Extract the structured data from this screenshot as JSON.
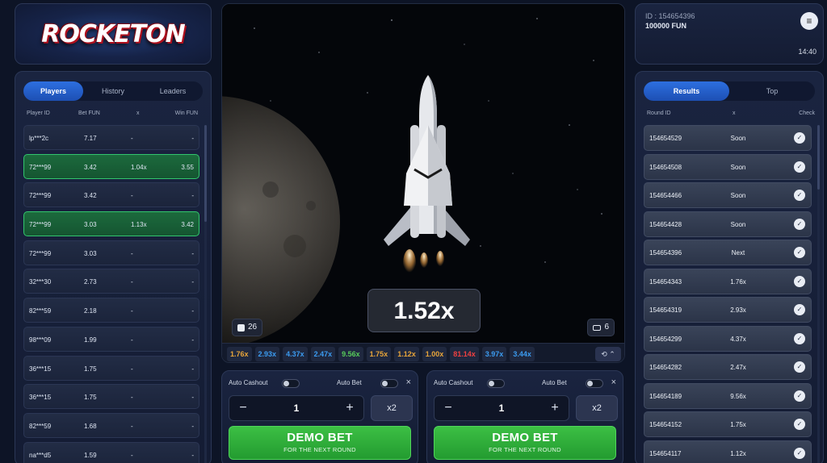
{
  "logo": {
    "text": "ROCKETON"
  },
  "players": {
    "tabs": [
      {
        "label": "Players",
        "active": true
      },
      {
        "label": "History",
        "active": false
      },
      {
        "label": "Leaders",
        "active": false
      }
    ],
    "columns": {
      "player_id": "Player ID",
      "bet": "Bet FUN",
      "x": "x",
      "win": "Win FUN"
    },
    "rows": [
      {
        "id": "lp***2c",
        "bet": "7.17",
        "x": "-",
        "win": "-",
        "won": false
      },
      {
        "id": "72***99",
        "bet": "3.42",
        "x": "1.04x",
        "win": "3.55",
        "won": true
      },
      {
        "id": "72***99",
        "bet": "3.42",
        "x": "-",
        "win": "-",
        "won": false
      },
      {
        "id": "72***99",
        "bet": "3.03",
        "x": "1.13x",
        "win": "3.42",
        "won": true
      },
      {
        "id": "72***99",
        "bet": "3.03",
        "x": "-",
        "win": "-",
        "won": false
      },
      {
        "id": "32***30",
        "bet": "2.73",
        "x": "-",
        "win": "-",
        "won": false
      },
      {
        "id": "82***59",
        "bet": "2.18",
        "x": "-",
        "win": "-",
        "won": false
      },
      {
        "id": "98***09",
        "bet": "1.99",
        "x": "-",
        "win": "-",
        "won": false
      },
      {
        "id": "36***15",
        "bet": "1.75",
        "x": "-",
        "win": "-",
        "won": false
      },
      {
        "id": "36***15",
        "bet": "1.75",
        "x": "-",
        "win": "-",
        "won": false
      },
      {
        "id": "82***59",
        "bet": "1.68",
        "x": "-",
        "win": "-",
        "won": false
      },
      {
        "id": "na***d5",
        "bet": "1.59",
        "x": "-",
        "win": "-",
        "won": false
      }
    ]
  },
  "game": {
    "multiplier": "1.52x",
    "players_count": "26",
    "bets_count": "6",
    "history": [
      {
        "value": "1.76x",
        "color": "#e8a53a"
      },
      {
        "value": "2.93x",
        "color": "#3b9bf0"
      },
      {
        "value": "4.37x",
        "color": "#3b9bf0"
      },
      {
        "value": "2.47x",
        "color": "#3b9bf0"
      },
      {
        "value": "9.56x",
        "color": "#57cc5a"
      },
      {
        "value": "1.75x",
        "color": "#e8a53a"
      },
      {
        "value": "1.12x",
        "color": "#e8a53a"
      },
      {
        "value": "1.00x",
        "color": "#e8a53a"
      },
      {
        "value": "81.14x",
        "color": "#f04040"
      },
      {
        "value": "3.97x",
        "color": "#3b9bf0"
      },
      {
        "value": "3.44x",
        "color": "#3b9bf0"
      }
    ]
  },
  "bets": [
    {
      "auto_cashout": "Auto Cashout",
      "auto_bet": "Auto Bet",
      "close": "×",
      "amount": "1",
      "minus": "−",
      "plus": "+",
      "double": "x2",
      "button": "DEMO BET",
      "subtitle": "FOR THE NEXT ROUND"
    },
    {
      "auto_cashout": "Auto Cashout",
      "auto_bet": "Auto Bet",
      "close": "×",
      "amount": "1",
      "minus": "−",
      "plus": "+",
      "double": "x2",
      "button": "DEMO BET",
      "subtitle": "FOR THE NEXT ROUND"
    }
  ],
  "account": {
    "id": "ID : 154654396",
    "balance": "100000 FUN",
    "time": "14:40",
    "menu_icon": "hamburger-icon"
  },
  "results": {
    "tabs": [
      {
        "label": "Results",
        "active": true
      },
      {
        "label": "Top",
        "active": false
      }
    ],
    "columns": {
      "round_id": "Round ID",
      "x": "x",
      "check": "Check"
    },
    "rows": [
      {
        "round": "154654529",
        "x": "Soon"
      },
      {
        "round": "154654508",
        "x": "Soon"
      },
      {
        "round": "154654466",
        "x": "Soon"
      },
      {
        "round": "154654428",
        "x": "Soon"
      },
      {
        "round": "154654396",
        "x": "Next"
      },
      {
        "round": "154654343",
        "x": "1.76x"
      },
      {
        "round": "154654319",
        "x": "2.93x"
      },
      {
        "round": "154654299",
        "x": "4.37x"
      },
      {
        "round": "154654282",
        "x": "2.47x"
      },
      {
        "round": "154654189",
        "x": "9.56x"
      },
      {
        "round": "154654152",
        "x": "1.75x"
      },
      {
        "round": "154654117",
        "x": "1.12x"
      }
    ]
  }
}
